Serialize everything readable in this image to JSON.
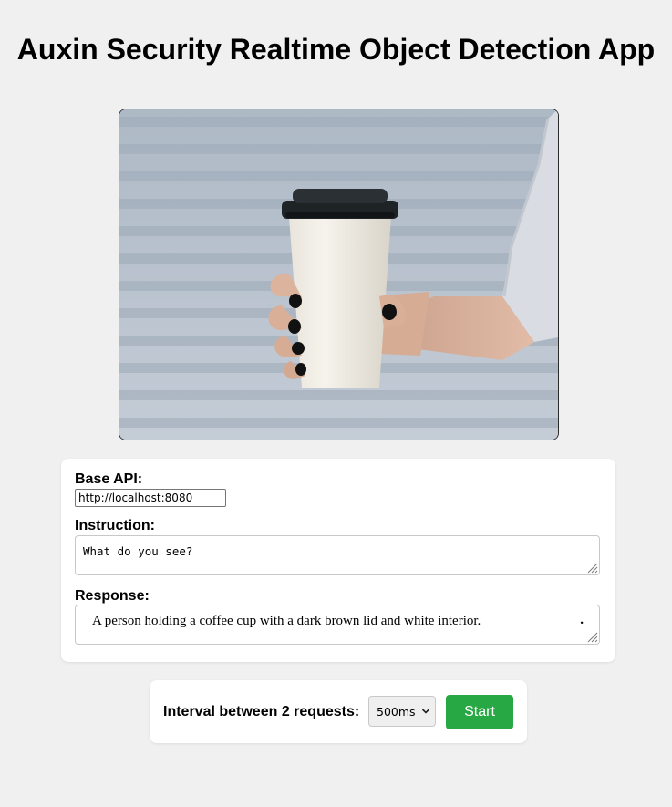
{
  "app": {
    "title": "Auxin Security Realtime Object Detection App"
  },
  "video": {
    "icon": "camera-feed",
    "scene": "hand holding paper coffee cup"
  },
  "controls": {
    "base_api_label": "Base API:",
    "base_api_value": "http://localhost:8080",
    "instruction_label": "Instruction:",
    "instruction_value": "What do you see?",
    "response_label": "Response:",
    "response_value": "A person holding a coffee cup with a dark brown lid and white interior.",
    "response_trailing": "."
  },
  "interval": {
    "label": "Interval between 2 requests:",
    "selected": "500ms",
    "start_label": "Start"
  },
  "colors": {
    "background": "#f0f0f0",
    "card": "#ffffff",
    "start_button": "#28a745"
  }
}
